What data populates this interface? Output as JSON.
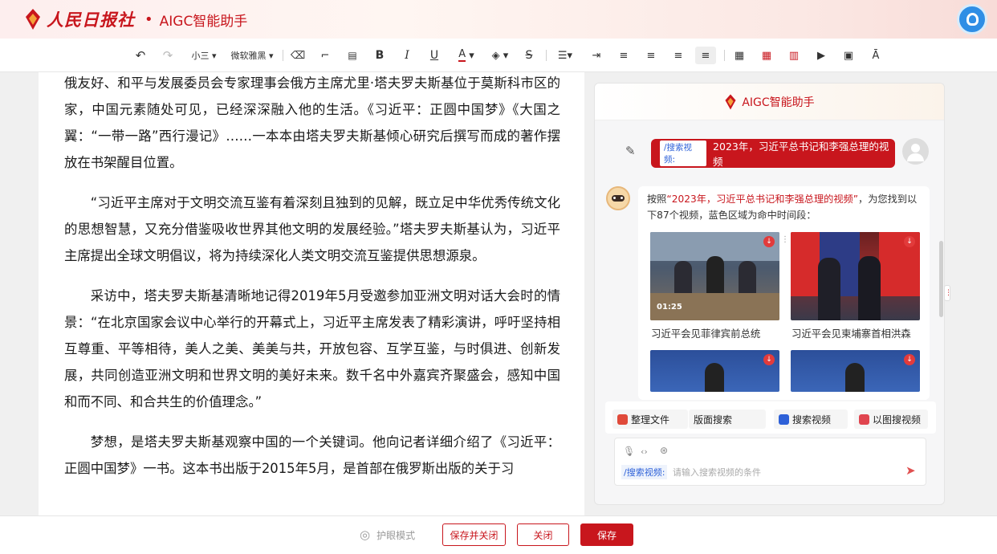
{
  "header": {
    "brand": "人民日报社",
    "title": "AIGC智能助手"
  },
  "toolbar": {
    "font_size": "小三",
    "font_family": "微软雅黑"
  },
  "document": {
    "paragraphs": [
      "俄友好、和平与发展委员会专家理事会俄方主席尤里·塔夫罗夫斯基位于莫斯科市区的家，中国元素随处可见，已经深深融入他的生活。《习近平：正圆中国梦》《大国之翼：“一带一路”西行漫记》……一本本由塔夫罗夫斯基倾心研究后撰写而成的著作摆放在书架醒目位置。",
      "“习近平主席对于文明交流互鉴有着深刻且独到的见解，既立足中华优秀传统文化的思想智慧，又充分借鉴吸收世界其他文明的发展经验。”塔夫罗夫斯基认为，习近平主席提出全球文明倡议，将为持续深化人类文明交流互鉴提供思想源泉。",
      "采访中，塔夫罗夫斯基清晰地记得2019年5月受邀参加亚洲文明对话大会时的情景：“在北京国家会议中心举行的开幕式上，习近平主席发表了精彩演讲，呼吁坚持相互尊重、平等相待，美人之美、美美与共，开放包容、互学互鉴，与时俱进、创新发展，共同创造亚洲文明和世界文明的美好未来。数千名中外嘉宾齐聚盛会，感知中国和而不同、和合共生的价值理念。”",
      "梦想，是塔夫罗夫斯基观察中国的一个关键词。他向记者详细介绍了《习近平：正圆中国梦》一书。这本书出版于2015年5月，是首部在俄罗斯出版的关于习"
    ]
  },
  "assistant": {
    "title": "AIGC智能助手",
    "query_tag": "/搜索视频:",
    "query_text": "2023年，习近平总书记和李强总理的视频",
    "answer_prefix": "按照",
    "answer_quote": "“2023年，习近平总书记和李强总理的视频”",
    "answer_suffix": "，为您找到以下87个视频，蓝色区域为命中时间段：",
    "videos": [
      {
        "caption": "习近平会见菲律宾前总统",
        "duration": "01:25"
      },
      {
        "caption": "习近平会见柬埔寨首相洪森",
        "duration": ""
      },
      {
        "caption": "",
        "duration": ""
      },
      {
        "caption": "",
        "duration": ""
      }
    ],
    "actions": [
      "整理文件",
      "版面搜索",
      "搜索视频",
      "以图搜视频"
    ],
    "input_tag": "/搜索视频:",
    "input_placeholder": "请输入搜索视频的条件"
  },
  "footer": {
    "eye_mode": "护眼模式",
    "save_close": "保存并关闭",
    "close": "关闭",
    "save": "保存"
  },
  "colors": {
    "brand_red": "#c8161d",
    "tag_blue": "#2e61d8"
  }
}
